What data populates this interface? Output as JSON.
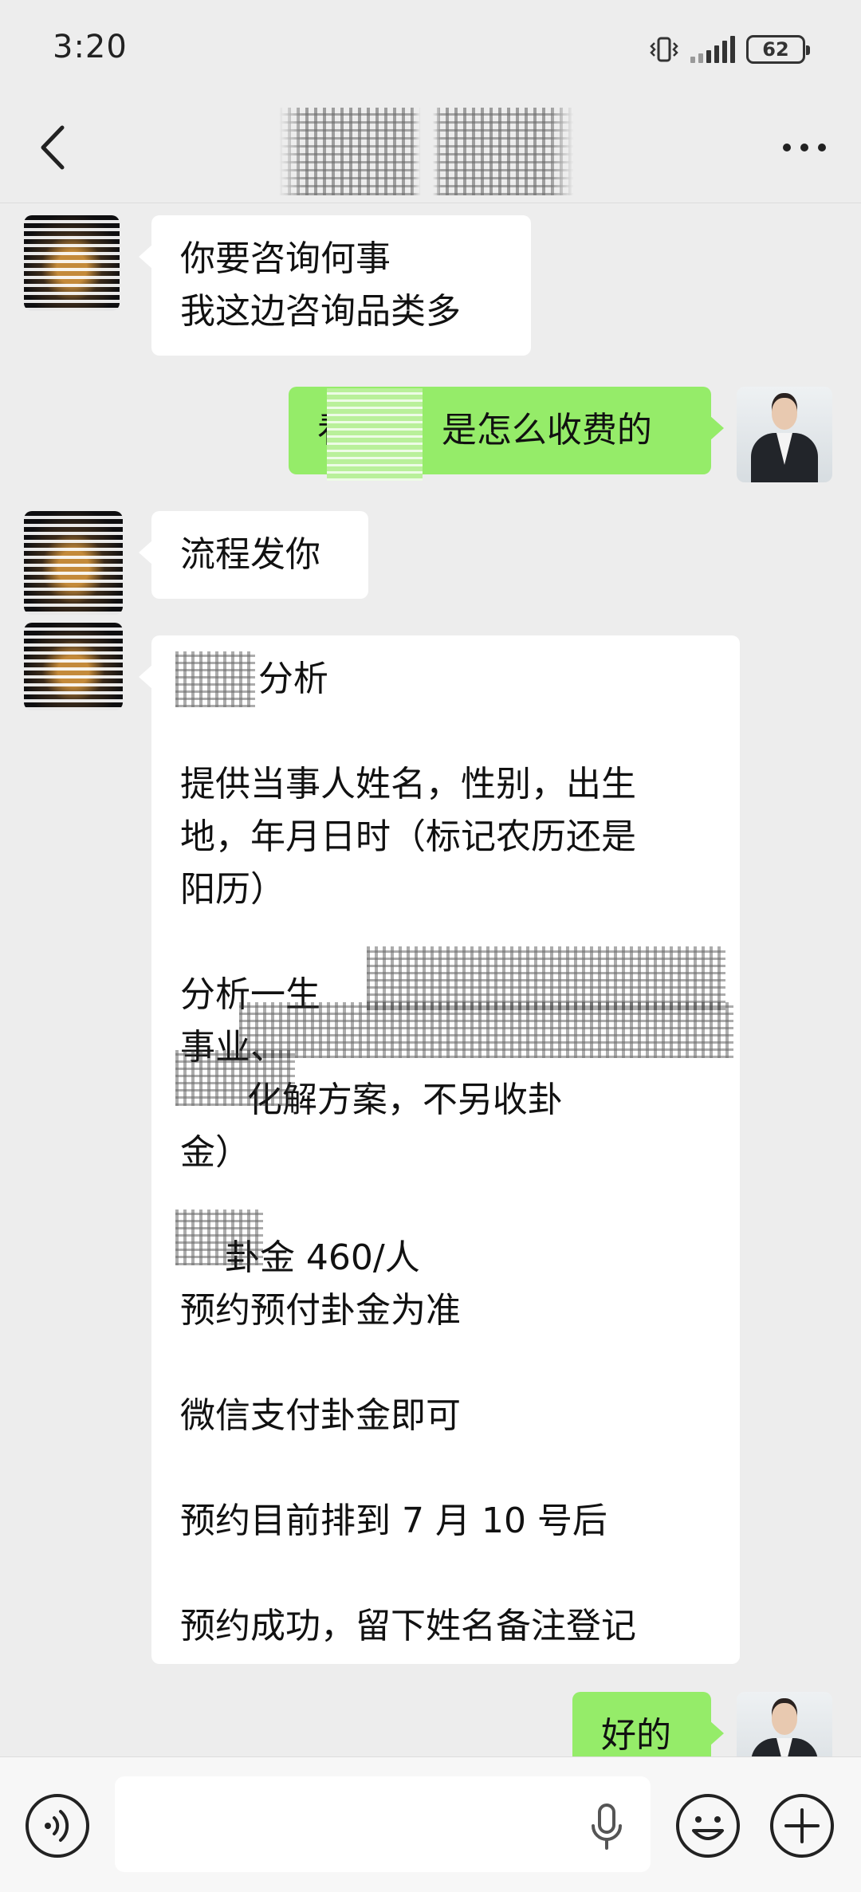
{
  "status_bar": {
    "time": "3:20",
    "battery": "62"
  },
  "nav": {
    "back_icon": "chevron-left-icon",
    "more_icon": "more-dots-icon"
  },
  "messages": [
    {
      "sender": "other",
      "lines": [
        "你要咨询何事",
        "我这边咨询品类多"
      ]
    },
    {
      "sender": "self",
      "lines": [
        "看        是怎么收费的"
      ]
    },
    {
      "sender": "other",
      "lines": [
        "流程发你"
      ]
    },
    {
      "sender": "other",
      "lines": [
        "       分析",
        "",
        "提供当事人姓名，性别，出生",
        "地，年月日时（标记农历还是",
        "阳历）",
        "",
        "分析一生",
        "事业、",
        "      化解方案，不另收卦",
        "金）",
        "",
        "    卦金 460/人",
        "预约预付卦金为准",
        "",
        "微信支付卦金即可",
        "",
        "预约目前排到 7 月 10 号后",
        "",
        "预约成功，留下姓名备注登记"
      ]
    },
    {
      "sender": "self",
      "lines": [
        "好的"
      ]
    }
  ],
  "input": {
    "value": "",
    "placeholder": ""
  },
  "colors": {
    "self_bubble": "#95ec69",
    "other_bubble": "#ffffff",
    "background": "#ededed"
  }
}
